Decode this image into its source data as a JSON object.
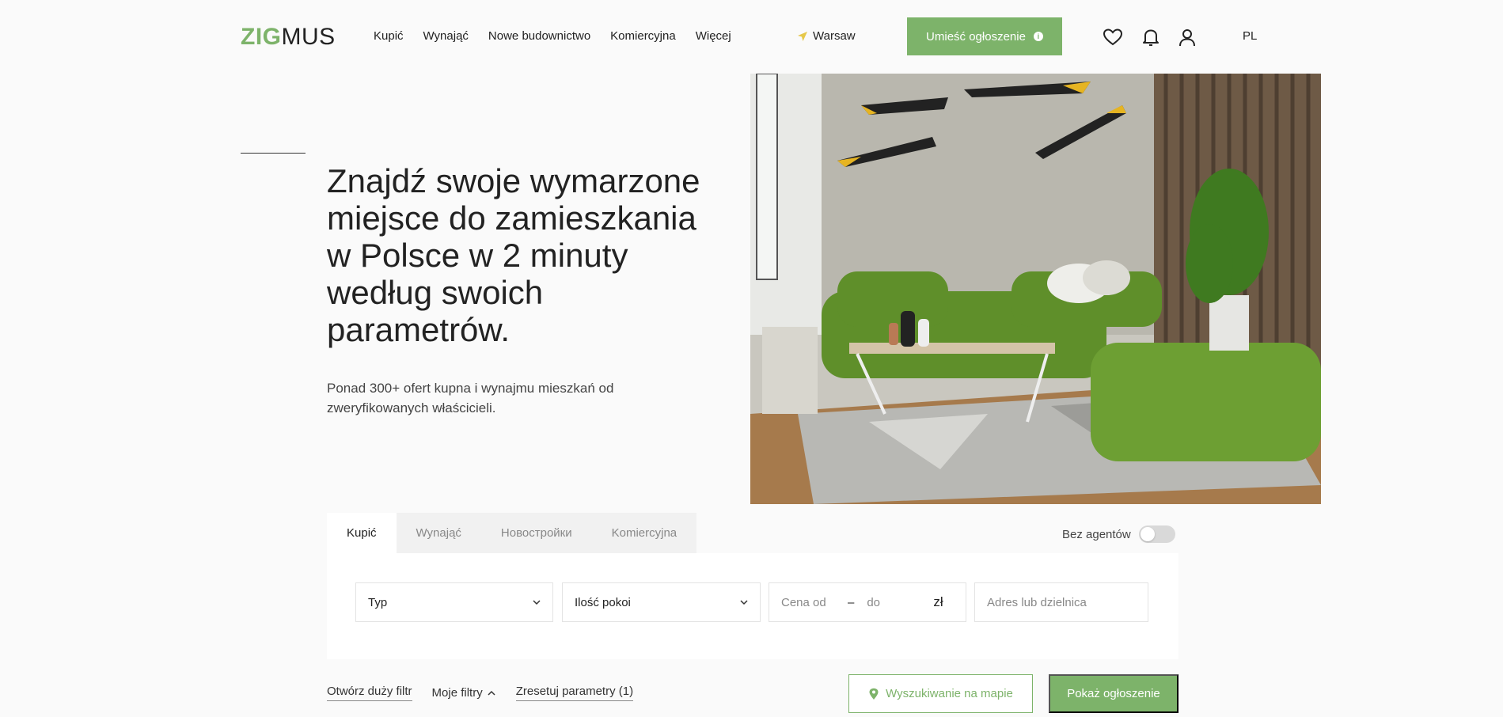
{
  "header": {
    "logo_zig": "ZIG",
    "logo_mus": "MUS",
    "nav": [
      "Kupić",
      "Wynająć",
      "Nowe budownictwo",
      "Komiercyjna",
      "Więcej"
    ],
    "city": "Warsaw",
    "post_button": "Umieść ogłoszenie",
    "lang": "PL",
    "icons": [
      "heart-icon",
      "bell-icon",
      "user-icon"
    ],
    "accent": "#7db36a"
  },
  "hero": {
    "title": "Znajdź swoje wymarzone miejsce do zamieszkania w Polsce w 2 minuty według swoich parametrów.",
    "subtitle": "Ponad 300+ ofert kupna i wynajmu mieszkań od zweryfikowanych właścicieli."
  },
  "search": {
    "tabs": [
      "Kupić",
      "Wynająć",
      "Новостройки",
      "Komiercyjna"
    ],
    "active_tab": "Kupić",
    "no_agents_label": "Bez agentów",
    "no_agents_on": false,
    "type_select": "Typ",
    "rooms_select": "Ilość pokoi",
    "price_from": "Cena od",
    "price_dash": "–",
    "price_to": "do",
    "currency": "zł",
    "address_placeholder": "Adres lub dzielnica",
    "open_filter": "Otwórz duży filtr",
    "my_filters": "Moje filtry",
    "reset": "Zresetuj parametry (1)",
    "map_search": "Wyszukiwanie na mapie",
    "show_button": "Pokaż ogłoszenie"
  }
}
